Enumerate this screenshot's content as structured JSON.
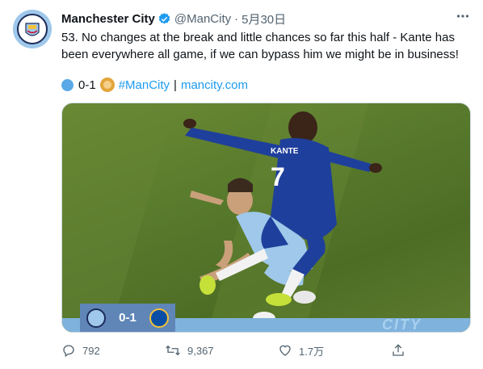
{
  "author": {
    "display_name": "Manchester City",
    "handle": "@ManCity",
    "separator": "·",
    "date": "5月30日"
  },
  "tweet": {
    "text": "53. No changes at the break and little chances so far this half - Kante has been everywhere all game, if we can bypass him we might be in business!",
    "score": "0-1",
    "hashtag": "#ManCity",
    "divider": "|",
    "link": "mancity.com"
  },
  "media": {
    "shirt_name": "KANTE",
    "shirt_number": "7",
    "score": "0-1",
    "banner_text": "CITY"
  },
  "actions": {
    "replies": "792",
    "retweets": "9,367",
    "likes": "1.7万"
  },
  "icons": {
    "verified": "verified-badge-icon",
    "more": "more-options-icon",
    "reply": "reply-icon",
    "retweet": "retweet-icon",
    "like": "heart-icon",
    "share": "share-icon"
  },
  "colors": {
    "link": "#1d9bf0",
    "muted": "#536471",
    "text": "#0f1419"
  }
}
